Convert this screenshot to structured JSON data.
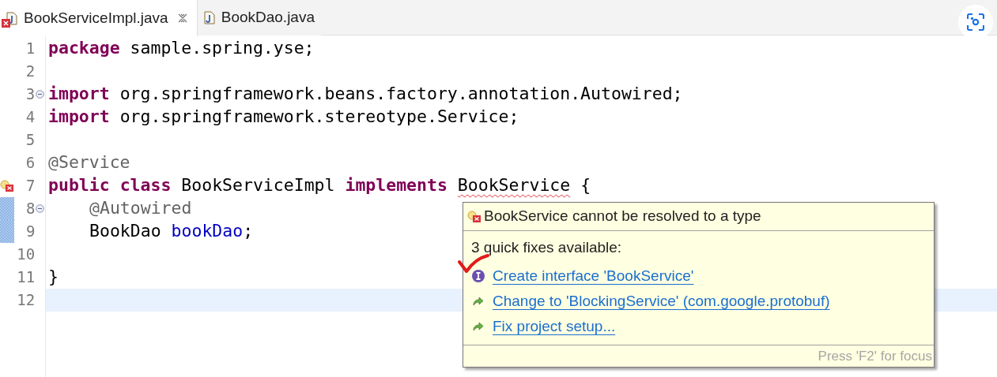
{
  "tabs": [
    {
      "label": "BookServiceImpl.java",
      "selected": true,
      "has_error": true,
      "closable": true
    },
    {
      "label": "BookDao.java",
      "selected": false,
      "has_error": false,
      "closable": false
    }
  ],
  "editor": {
    "lines": [
      {
        "number": "1",
        "tokens": [
          {
            "kind": "keyword",
            "text": "package"
          },
          {
            "kind": "plain",
            "text": "sample.spring.yse;"
          }
        ]
      },
      {
        "number": "2"
      },
      {
        "number": "3",
        "fold": true,
        "tokens": [
          {
            "kind": "keyword",
            "text": "import"
          },
          {
            "kind": "plain",
            "text": "org.springframework.beans.factory.annotation.Autowired;"
          }
        ]
      },
      {
        "number": "4",
        "tokens": [
          {
            "kind": "keyword",
            "text": "import"
          },
          {
            "kind": "plain",
            "text": "org.springframework.stereotype.Service;"
          }
        ]
      },
      {
        "number": "5"
      },
      {
        "number": "6",
        "tokens": [
          {
            "kind": "annotation",
            "text": "@Service"
          }
        ]
      },
      {
        "number": "7",
        "error": true,
        "tokens": [
          {
            "kind": "keyword",
            "text": "public"
          },
          {
            "kind": "keyword",
            "text": "class"
          },
          {
            "kind": "plain",
            "text": "BookServiceImpl"
          },
          {
            "kind": "keyword",
            "text": "implements"
          },
          {
            "kind": "error",
            "text": "BookService"
          },
          {
            "kind": "plain",
            "text": "{"
          }
        ]
      },
      {
        "number": "8",
        "fold": true,
        "changed": true,
        "indented": true,
        "tokens": [
          {
            "kind": "annotation",
            "text": "@Autowired"
          }
        ]
      },
      {
        "number": "9",
        "changed": true,
        "indented": true,
        "tokens": [
          {
            "kind": "plain",
            "text": "BookDao"
          },
          {
            "kind": "field",
            "text": "bookDao"
          },
          {
            "kind": "plain",
            "text": ";",
            "attached": true
          }
        ]
      },
      {
        "number": "10"
      },
      {
        "number": "11",
        "tokens": [
          {
            "kind": "plain",
            "text": "}"
          }
        ]
      },
      {
        "number": "12",
        "current": true
      }
    ]
  },
  "quick_fix_popup": {
    "problem": "BookService cannot be resolved to a type",
    "heading": "3 quick fixes available:",
    "fixes": [
      {
        "kind": "interface",
        "label": "Create interface 'BookService'",
        "marked": true
      },
      {
        "kind": "change",
        "label": "Change to 'BlockingService' (com.google.protobuf)",
        "marked": false
      },
      {
        "kind": "change",
        "label": "Fix project setup...",
        "marked": false
      }
    ],
    "footer": "Press 'F2' for focus"
  }
}
